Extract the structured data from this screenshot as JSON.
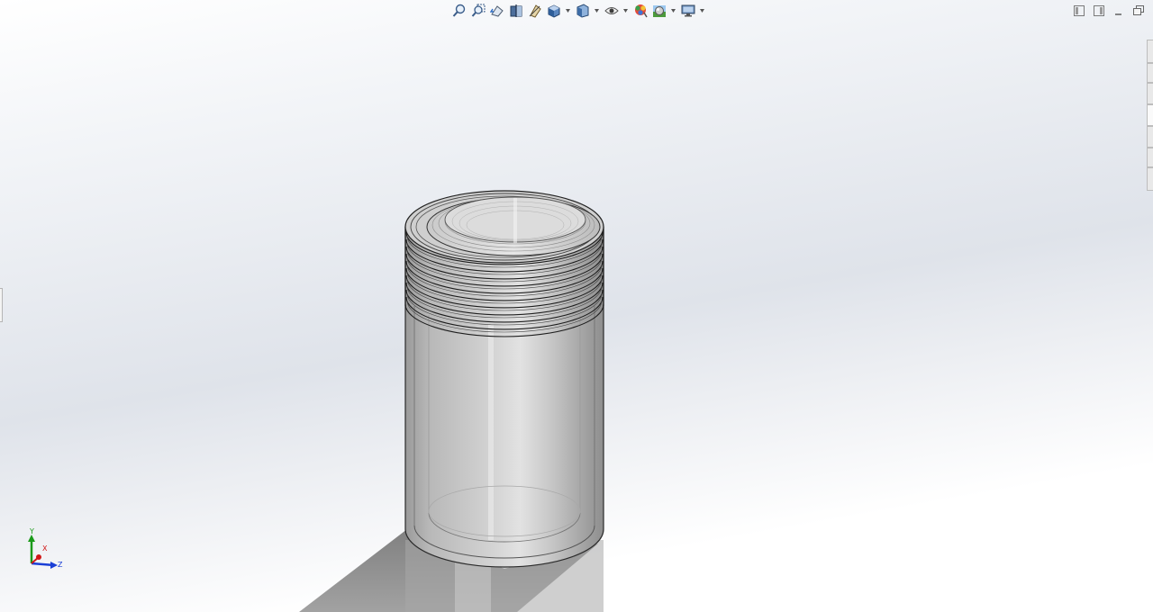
{
  "heads_up_toolbar": {
    "tools": [
      {
        "icon": "zoom-to-fit-icon"
      },
      {
        "icon": "zoom-to-area-icon"
      },
      {
        "icon": "previous-view-icon"
      },
      {
        "icon": "section-view-icon"
      },
      {
        "icon": "dynamic-annotation-views-icon"
      },
      {
        "icon": "view-orientation-icon",
        "dropdown": true
      },
      {
        "icon": "display-style-icon",
        "dropdown": true
      },
      {
        "icon": "hide-show-items-icon",
        "dropdown": true
      },
      {
        "icon": "edit-appearance-icon"
      },
      {
        "icon": "apply-scene-icon",
        "dropdown": true
      },
      {
        "icon": "view-settings-icon",
        "dropdown": true
      }
    ]
  },
  "window_controls": {
    "icons": [
      "tile-left-icon",
      "tile-right-icon",
      "minimize-icon",
      "restore-icon"
    ]
  },
  "triad": {
    "y_label": "Y",
    "x_label": "X",
    "z_label": "Z",
    "colors": {
      "y": "#1a9a1a",
      "x": "#d01818",
      "z": "#1a3fd6"
    }
  },
  "scene": {
    "part": "threaded-cylinder",
    "display_style": "shaded-with-edges",
    "model_color": "#bdbdbd",
    "edge_color": "#2a2a2a",
    "shadow_color": "#8c8c8c"
  }
}
